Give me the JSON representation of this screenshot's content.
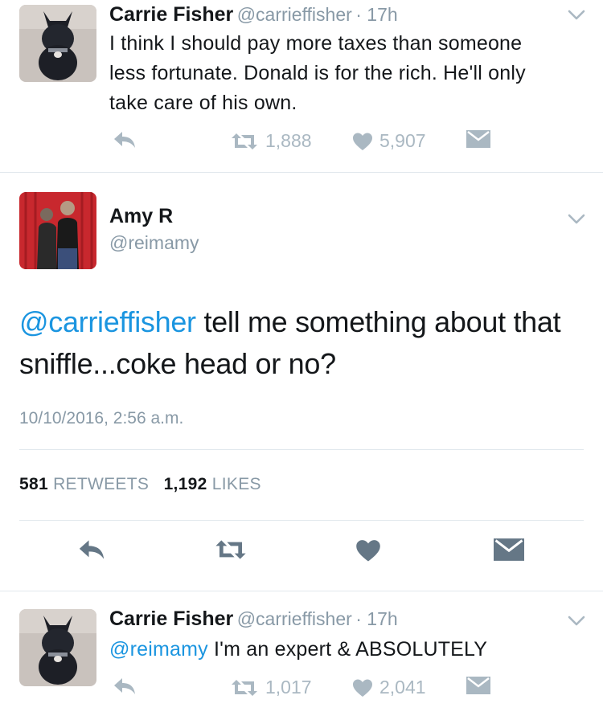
{
  "tweets": [
    {
      "name": "Carrie Fisher",
      "handle": "@carrieffisher",
      "time": "· 17h",
      "text": "I think I should pay more taxes than someone less fortunate. Donald is for the rich. He'll only take care of his own.",
      "retweets": "1,888",
      "likes": "5,907"
    },
    {
      "name": "Amy R",
      "handle": "@reimamy",
      "mention": "@carrieffisher",
      "text": " tell me something about that sniffle...coke head or no?",
      "timestamp": "10/10/2016, 2:56 a.m.",
      "retweet_count": "581",
      "retweet_label": "RETWEETS",
      "like_count": "1,192",
      "like_label": "LIKES"
    },
    {
      "name": "Carrie Fisher",
      "handle": "@carrieffisher",
      "time": "· 17h",
      "mention": "@reimamy",
      "text": " I'm an expert & ABSOLUTELY",
      "retweets": "1,017",
      "likes": "2,041"
    }
  ],
  "icons": {
    "reply": "reply-icon",
    "retweet": "retweet-icon",
    "like": "heart-icon",
    "dm": "envelope-icon",
    "menu": "chevron-down-icon"
  },
  "colors": {
    "link": "#1b95e0",
    "muted": "#8899a6",
    "icon": "#aab8c2",
    "icon_dark": "#657786",
    "divider": "#e1e8ed"
  }
}
